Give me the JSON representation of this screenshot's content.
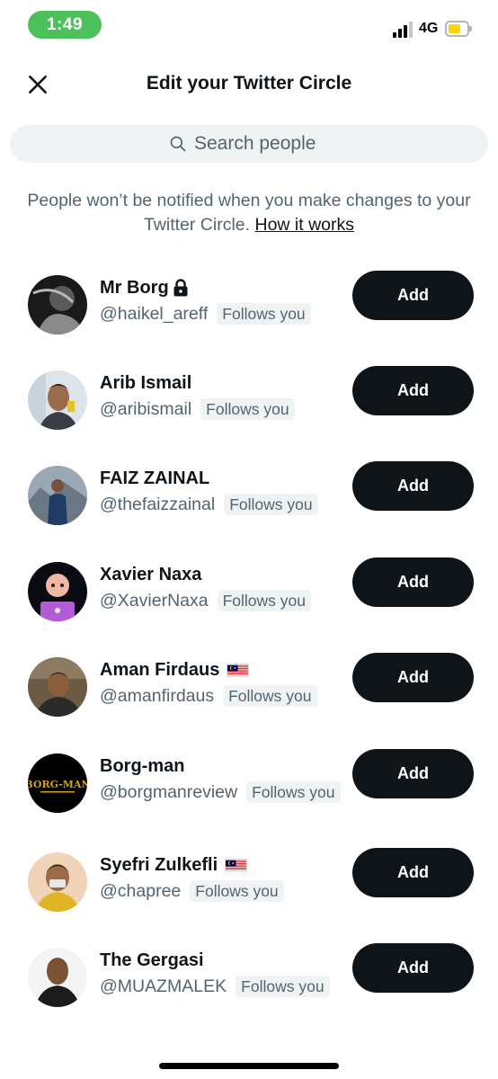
{
  "status_bar": {
    "time": "1:49",
    "network": "4G",
    "battery_level": 0.68
  },
  "header": {
    "title": "Edit your Twitter Circle"
  },
  "search": {
    "placeholder": "Search people"
  },
  "notice": {
    "text": "People won’t be notified when you make changes to your Twitter Circle.",
    "link": "How it works"
  },
  "people": [
    {
      "name": "Mr Borg",
      "handle": "@haikel_areff",
      "badge": "Follows you",
      "button": "Add",
      "icon": "lock-icon"
    },
    {
      "name": "Arib Ismail",
      "handle": "@aribismail",
      "badge": "Follows you",
      "button": "Add"
    },
    {
      "name": "FAIZ ZAINAL",
      "handle": "@thefaizzainal",
      "badge": "Follows you",
      "button": "Add"
    },
    {
      "name": "Xavier Naxa",
      "handle": "@XavierNaxa",
      "badge": "Follows you",
      "button": "Add"
    },
    {
      "name": "Aman Firdaus",
      "handle": "@amanfirdaus",
      "badge": "Follows you",
      "button": "Add",
      "icon": "malaysia-flag-icon"
    },
    {
      "name": "Borg-man",
      "handle": "@borgmanreview",
      "badge": "Follows you",
      "button": "Add",
      "avatar_text": "BORG-MAN"
    },
    {
      "name": "Syefri Zulkefli",
      "handle": "@chapree",
      "badge": "Follows you",
      "button": "Add",
      "icon": "malaysia-flag-icon"
    },
    {
      "name": "The Gergasi",
      "handle": "@MUAZMALEK",
      "badge": "Follows you",
      "button": "Add"
    }
  ],
  "colors": {
    "accent_pill": "#4cc15a",
    "button_bg": "#0f1419",
    "muted_text": "#536471",
    "badge_bg": "#eff3f4"
  }
}
